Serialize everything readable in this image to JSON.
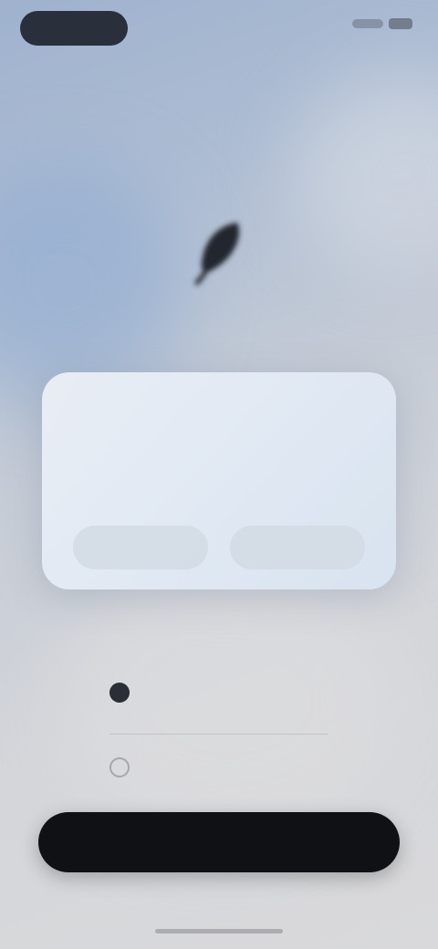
{
  "header": {
    "title": ""
  },
  "app": {
    "name": "",
    "icon": "feather-icon"
  },
  "dialog": {
    "title": "",
    "message": "",
    "buttons": [
      {
        "label": ""
      },
      {
        "label": ""
      }
    ]
  },
  "options": [
    {
      "label": "",
      "selected": true
    },
    {
      "label": "",
      "selected": false
    }
  ],
  "primary_button": {
    "label": ""
  },
  "colors": {
    "background_top": "#9fb2ce",
    "background_bottom": "#d9d9db",
    "dialog": "#e4ebf4",
    "primary_button": "#101114"
  }
}
